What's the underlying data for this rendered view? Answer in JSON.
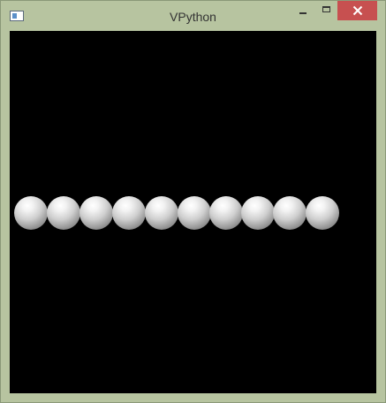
{
  "window": {
    "title": "VPython",
    "icon": "window-app-icon",
    "controls": {
      "minimize_icon": "minimize-icon",
      "maximize_icon": "maximize-icon",
      "close_icon": "close-icon",
      "close_color": "#c75050"
    },
    "frame_color": "#b7c4a0"
  },
  "scene": {
    "background_color": "#000000",
    "sphere_color": "#e0e0e0",
    "sphere_count": 10
  }
}
